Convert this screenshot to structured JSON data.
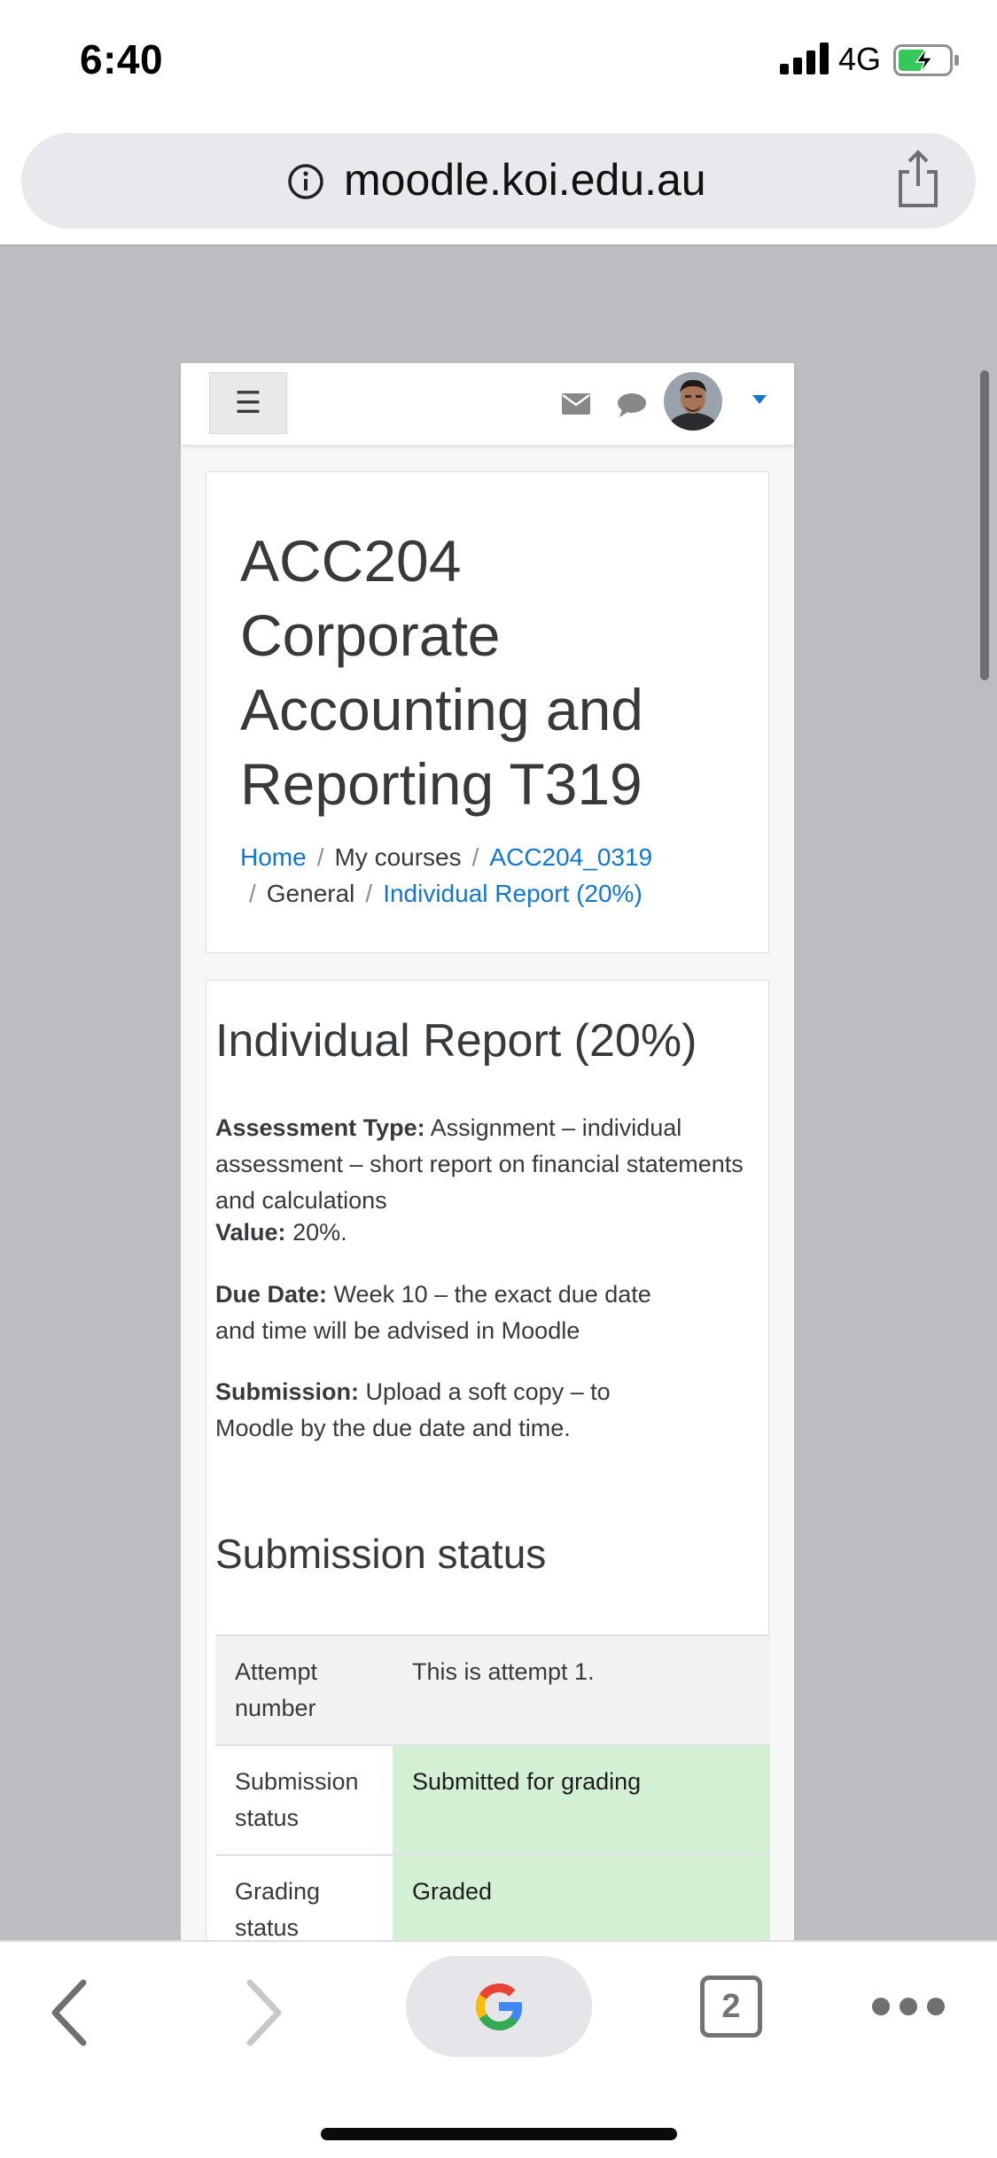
{
  "status_bar": {
    "time": "6:40",
    "network": "4G"
  },
  "address_bar": {
    "url": "moodle.koi.edu.au"
  },
  "navbar": {
    "menu_icon": "☰"
  },
  "course": {
    "title": "ACC204 Corporate Accounting and Reporting T319"
  },
  "breadcrumb": {
    "items": [
      "Home",
      "My courses",
      "ACC204_0319",
      "General",
      "Individual Report (20%)"
    ],
    "separator": "/"
  },
  "activity": {
    "title": "Individual Report (20%)",
    "assessment_type_label": "Assessment Type:",
    "assessment_type_text": "Assignment – individual assessment – short report on financial statements and calculations",
    "value_label": "Value:",
    "value_text": "20%.",
    "due_date_label": "Due Date:",
    "due_date_text": "Week 10 – the exact due date and time will be advised in Moodle",
    "submission_label": "Submission:",
    "submission_text": "Upload a soft copy – to Moodle by the due date and time."
  },
  "submission_status": {
    "heading": "Submission status",
    "rows": [
      {
        "label": "Attempt number",
        "value": "This is attempt 1."
      },
      {
        "label": "Submission status",
        "value": "Submitted for grading"
      },
      {
        "label": "Grading status",
        "value": "Graded"
      }
    ]
  },
  "toolbar": {
    "tab_count": "2"
  },
  "colors": {
    "link": "#1177d1",
    "success_bg": "#d3efd4",
    "viewport_bg": "#bcbcc2"
  }
}
